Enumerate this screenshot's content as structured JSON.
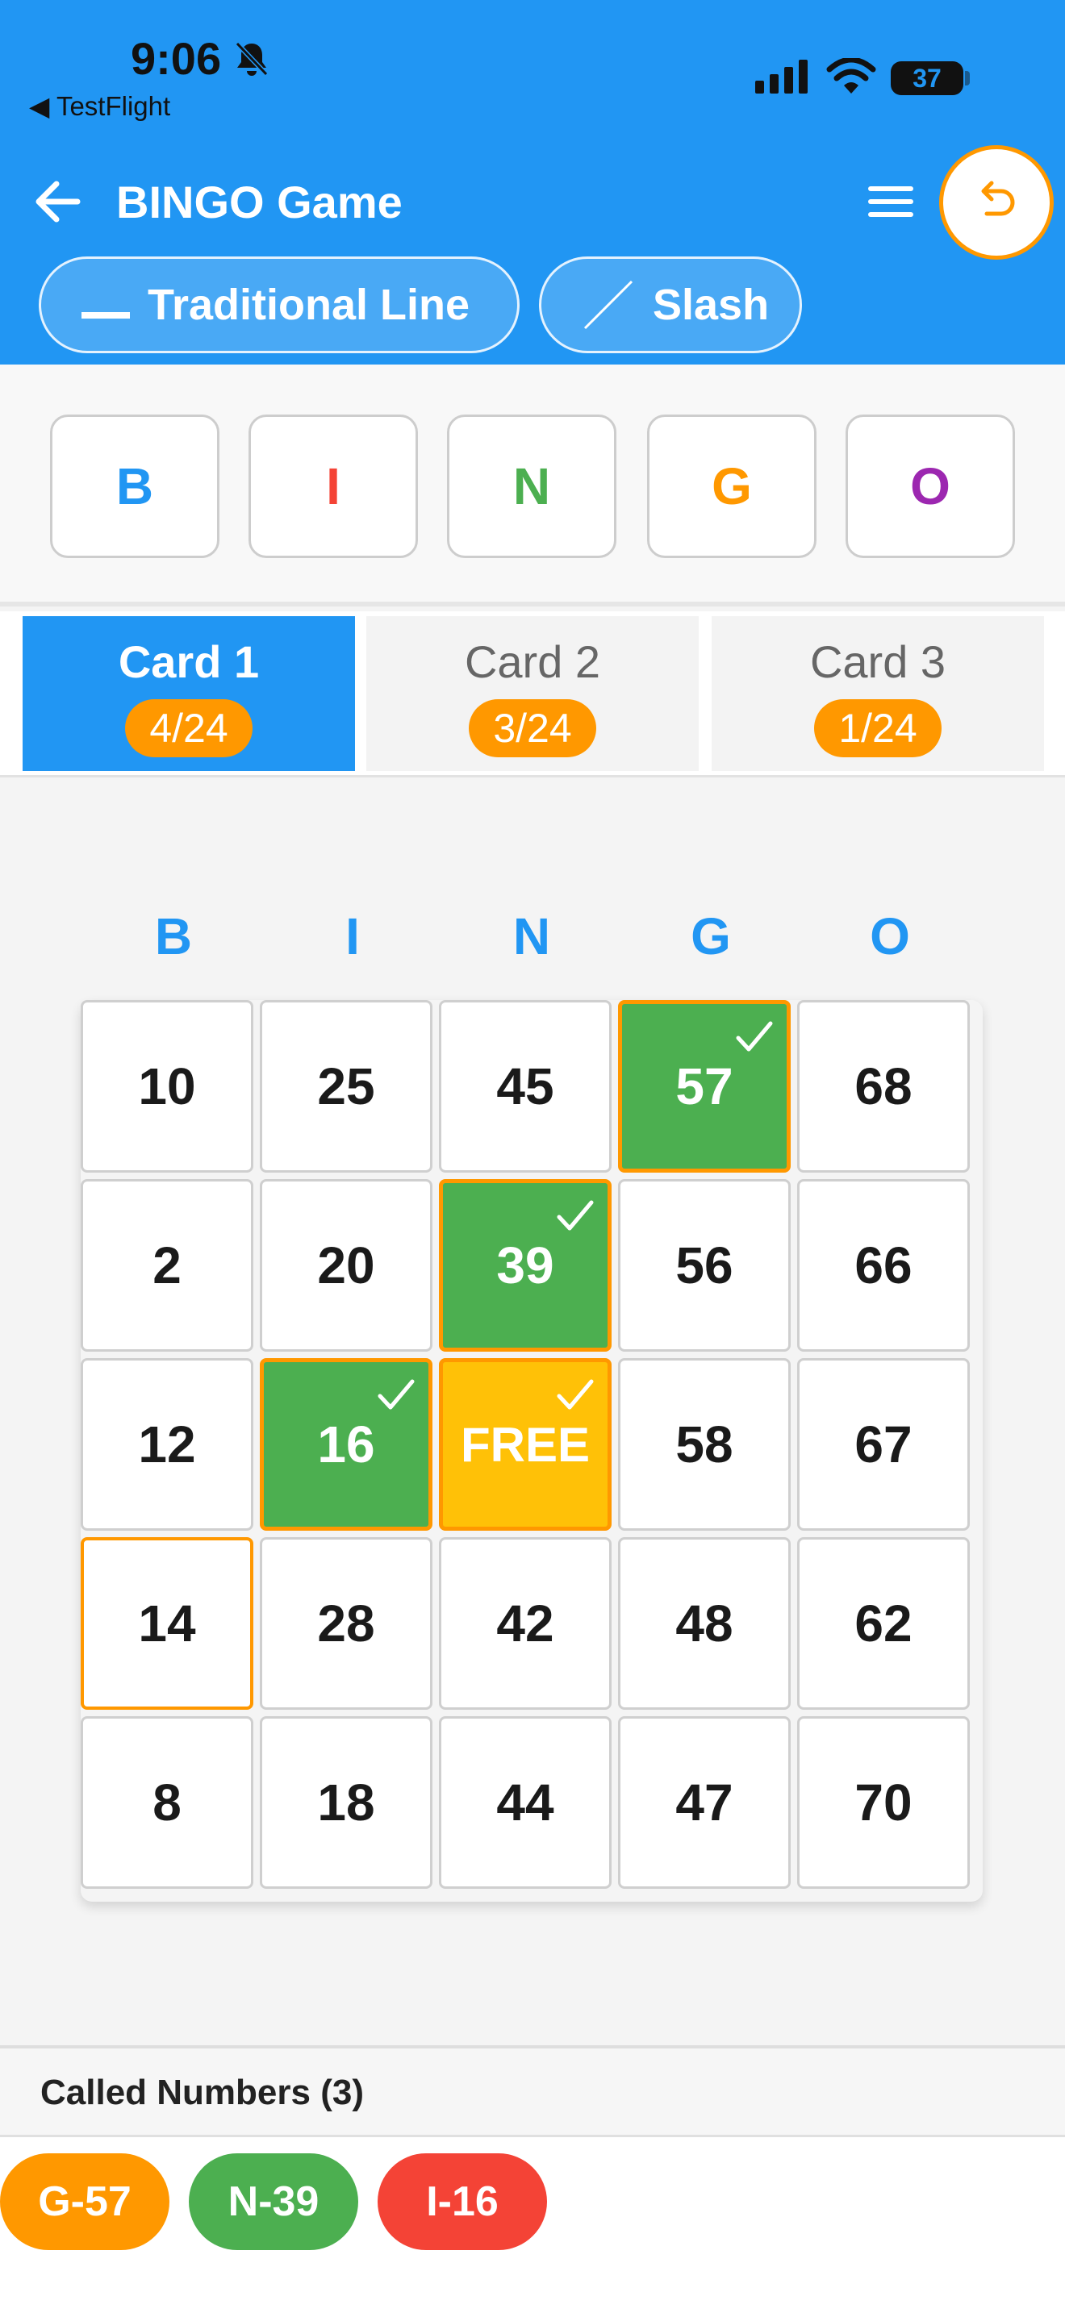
{
  "status_bar": {
    "time": "9:06",
    "back_app": "◀ TestFlight",
    "battery": "37"
  },
  "header": {
    "title": "BINGO Game",
    "icons": [
      "back-arrow-icon",
      "menu-icon",
      "undo-icon"
    ]
  },
  "modes": [
    {
      "label": "Traditional Line",
      "icon": "line-icon"
    },
    {
      "label": "Slash",
      "icon": "slash-icon"
    }
  ],
  "letters": [
    {
      "letter": "B",
      "color": "#2196f3"
    },
    {
      "letter": "I",
      "color": "#f44336"
    },
    {
      "letter": "N",
      "color": "#4caf50"
    },
    {
      "letter": "G",
      "color": "#ff9800"
    },
    {
      "letter": "O",
      "color": "#9c27b0"
    }
  ],
  "tabs": [
    {
      "label": "Card 1",
      "badge": "4/24",
      "active": true
    },
    {
      "label": "Card 2",
      "badge": "3/24",
      "active": false
    },
    {
      "label": "Card 3",
      "badge": "1/24",
      "active": false
    }
  ],
  "card": {
    "columns": [
      "B",
      "I",
      "N",
      "G",
      "O"
    ],
    "rows": [
      [
        {
          "v": "10"
        },
        {
          "v": "25"
        },
        {
          "v": "45"
        },
        {
          "v": "57",
          "marked": true
        },
        {
          "v": "68"
        }
      ],
      [
        {
          "v": "2"
        },
        {
          "v": "20"
        },
        {
          "v": "39",
          "marked": true
        },
        {
          "v": "56"
        },
        {
          "v": "66"
        }
      ],
      [
        {
          "v": "12"
        },
        {
          "v": "16",
          "marked": true
        },
        {
          "v": "FREE",
          "free": true
        },
        {
          "v": "58"
        },
        {
          "v": "67"
        }
      ],
      [
        {
          "v": "14",
          "highlight": true
        },
        {
          "v": "28"
        },
        {
          "v": "42"
        },
        {
          "v": "48"
        },
        {
          "v": "62"
        }
      ],
      [
        {
          "v": "8"
        },
        {
          "v": "18"
        },
        {
          "v": "44"
        },
        {
          "v": "47"
        },
        {
          "v": "70"
        }
      ]
    ]
  },
  "called": {
    "title": "Called Numbers (3)",
    "numbers": [
      {
        "label": "G-57",
        "color": "#ff9800"
      },
      {
        "label": "N-39",
        "color": "#4caf50"
      },
      {
        "label": "I-16",
        "color": "#f44336"
      }
    ]
  },
  "colors": {
    "primary": "#2196f3",
    "accent": "#ff9800",
    "marked": "#4caf50",
    "free": "#ffc107"
  }
}
